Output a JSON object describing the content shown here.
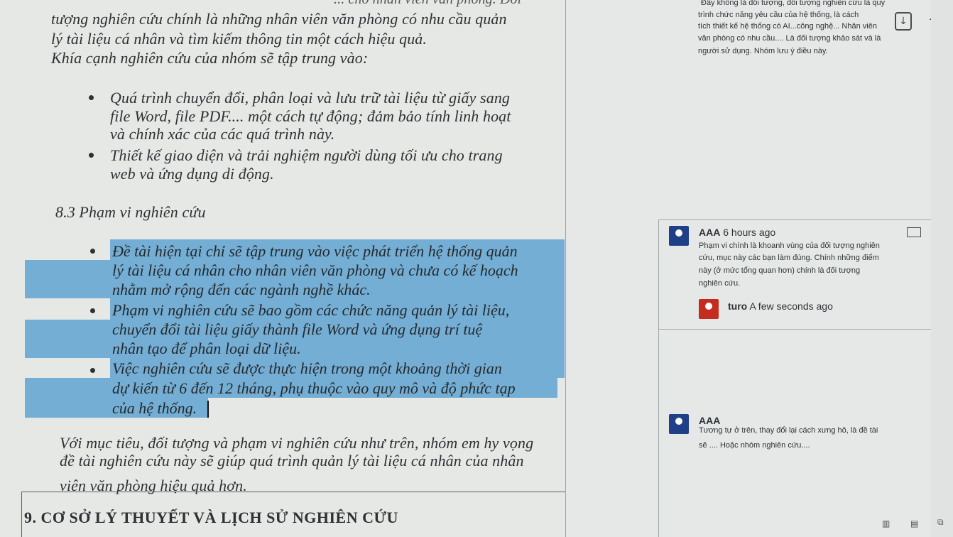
{
  "document": {
    "top_partial": "... cho nhân viên văn phòng. Đối",
    "intro_lines": [
      "tượng nghiên cứu chính là những nhân viên văn phòng có nhu cầu quản",
      "lý tài liệu cá nhân và tìm kiếm thông tin một cách hiệu quả.",
      "Khía cạnh nghiên cứu của nhóm sẽ tập trung vào:"
    ],
    "focus_bullets": [
      [
        "Quá trình chuyển đổi, phân loại và lưu trữ tài liệu từ giấy sang",
        "file Word, file PDF.... một cách tự động; đảm bảo tính linh hoạt",
        "và chính xác của các quá trình này."
      ],
      [
        "Thiết kế giao diện và trải nghiệm người dùng tối ưu cho trang",
        "web và ứng dụng di động."
      ]
    ],
    "section_title": "8.3 Phạm vi nghiên cứu",
    "scope_bullets": [
      [
        "Đề tài hiện tại chỉ sẽ tập trung vào việc phát triển hệ thống quản",
        "lý tài liệu cá nhân cho nhân viên văn phòng và chưa có kế hoạch",
        "nhằm mở rộng đến các ngành nghề khác."
      ],
      [
        "Phạm vi nghiên cứu sẽ bao gồm các chức năng quản lý tài liệu,",
        "chuyển đổi tài liệu giấy thành file Word và ứng dụng trí tuệ",
        "nhân tạo để phân loại dữ liệu."
      ],
      [
        "Việc nghiên cứu sẽ được thực hiện trong một khoảng thời gian",
        "dự kiến từ 6 đến 12 tháng, phụ thuộc vào quy mô và độ phức tạp",
        "của hệ thống."
      ]
    ],
    "conclusion_lines": [
      "Với mục tiêu, đối tượng và phạm vi nghiên cứu như trên, nhóm em hy vọng",
      "đề tài nghiên cứu này sẽ giúp quá trình quản lý tài liệu cá nhân của nhân",
      "viên văn phòng hiệu quả hơn."
    ],
    "next_heading": "9. CƠ SỞ LÝ THUYẾT VÀ LỊCH SỬ NGHIÊN CỨU"
  },
  "comments": {
    "top_comment_lines": [
      "Đây không là đối tượng, đối tượng nghiên cứu là quy",
      "trình chức năng yêu cầu của hệ thống, là cách",
      "tích thiết kế hệ thống có AI...công nghệ... Nhân viên",
      "văn phòng có nhu cầu.... Là đối tượng khảo sát và là",
      "người sử dụng. Nhóm lưu ý điều này."
    ],
    "thread1": {
      "author": "AAA",
      "time": "6 hours ago",
      "lines": [
        "Phạm vi chính là khoanh vùng của đối tượng nghiên",
        "cứu, mục này các bạn làm đúng. Chính những điểm",
        "này (ở mức tổng quan hơn) chính là đối tượng",
        "nghiên cứu."
      ],
      "reply_author": "turo",
      "reply_time": "A few seconds ago"
    },
    "thread2": {
      "author": "AAA",
      "lines": [
        "Tương tự ở trên, thay đổi lại cách xưng hô, là đề tài",
        "sẽ .... Hoặc nhóm nghiên cứu...."
      ]
    }
  },
  "icons": {
    "download": "download-icon",
    "share": "share-icon",
    "read_mode": "read-mode-icon",
    "print_layout": "print-layout-icon",
    "web_layout": "web-layout-icon"
  }
}
